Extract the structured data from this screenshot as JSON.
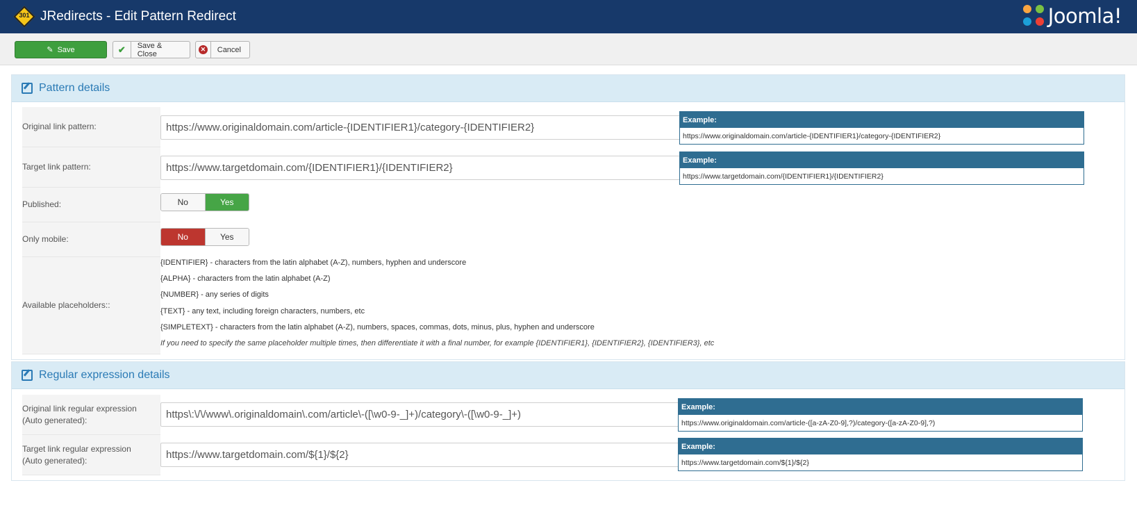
{
  "header": {
    "title": "JRedirects - Edit Pattern Redirect",
    "app_logo_text": "301",
    "brand": "Joomla!"
  },
  "toolbar": {
    "save_label": "Save",
    "save_close_label": "Save & Close",
    "cancel_label": "Cancel"
  },
  "pattern": {
    "title": "Pattern details",
    "original_label": "Original link pattern:",
    "original_value": "https://www.originaldomain.com/article-{IDENTIFIER1}/category-{IDENTIFIER2}",
    "original_example_title": "Example:",
    "original_example": "https://www.originaldomain.com/article-{IDENTIFIER1}/category-{IDENTIFIER2}",
    "target_label": "Target link pattern:",
    "target_value": "https://www.targetdomain.com/{IDENTIFIER1}/{IDENTIFIER2}",
    "target_example_title": "Example:",
    "target_example": "https://www.targetdomain.com/{IDENTIFIER1}/{IDENTIFIER2}",
    "published_label": "Published:",
    "published_no": "No",
    "published_yes": "Yes",
    "published_selected": "Yes",
    "mobile_label": "Only mobile:",
    "mobile_no": "No",
    "mobile_yes": "Yes",
    "mobile_selected": "No",
    "placeholders_label": "Available placeholders::",
    "placeholders": [
      "{IDENTIFIER} - characters from the latin alphabet (A-Z), numbers, hyphen and underscore",
      "{ALPHA} - characters from the latin alphabet (A-Z)",
      "{NUMBER} - any series of digits",
      "{TEXT} - any text, including foreign characters, numbers, etc",
      "{SIMPLETEXT} - characters from the latin alphabet (A-Z), numbers, spaces, commas, dots, minus, plus, hyphen and underscore"
    ],
    "placeholders_note": "If you need to specify the same placeholder multiple times, then differentiate it with a final number, for example {IDENTIFIER1}, {IDENTIFIER2}, {IDENTIFIER3}, etc"
  },
  "regex": {
    "title": "Regular expression details",
    "original_label_1": "Original link regular expression",
    "original_label_2": "(Auto generated):",
    "original_value": "https\\:\\/\\/www\\.originaldomain\\.com/article\\-([\\w0-9-_]+)/category\\-([\\w0-9-_]+)",
    "original_example_title": "Example:",
    "original_example": "https://www.originaldomain.com/article-([a-zA-Z0-9],?)/category-([a-zA-Z0-9],?)",
    "target_label_1": "Target link regular expression",
    "target_label_2": "(Auto generated):",
    "target_value": "https://www.targetdomain.com/${1}/${2}",
    "target_example_title": "Example:",
    "target_example": "https://www.targetdomain.com/${1}/${2}"
  },
  "colors": {
    "header_bg": "#17396a",
    "save_green": "#3e9f3e",
    "panel_accent": "#2a7ab5",
    "example_header": "#2f6d91",
    "toggle_red": "#bd362f"
  }
}
